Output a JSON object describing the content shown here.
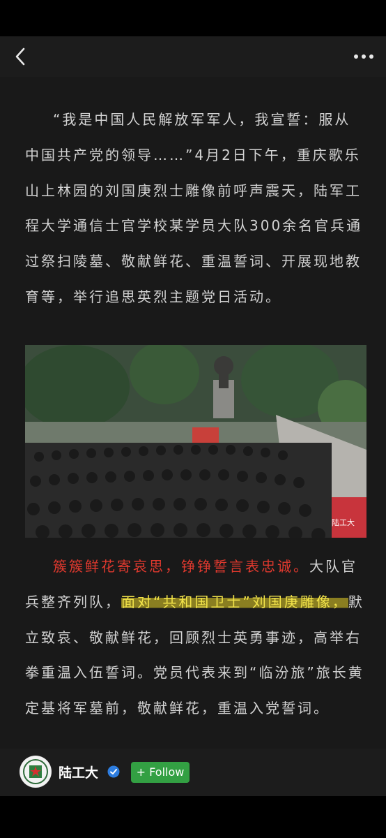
{
  "nav": {
    "back_icon": "chevron-left-icon",
    "more_icon": "ellipsis-icon"
  },
  "article": {
    "p1": "“我是中国人民解放军军人，我宣誓：服从中国共产党的领导……”4月2日下午，重庆歌乐山上林园的刘国庚烈士雕像前呼声震天，陆军工程大学通信士官学校某学员大队300余名官兵通过祭扫陵墓、敬献鲜花、重温誓词、开展现地教育等，举行追思英烈主题党日活动。",
    "photo_watermark": "陆工大",
    "p2_red": "簇簇鲜花寄哀思，铮铮誓言表忠诚。",
    "p2_a": "大队官兵整齐列队，",
    "p2_highlight": "面对“共和国卫士”刘国庚雕像，",
    "p2_b": "默立致哀、敬献鲜花，回顾烈士英勇事迹，高举右拳重温入伍誓词。党员代表来到“临汾旅”旅长黄定基将军墓前，敬献鲜花，重温入党誓词。"
  },
  "footer": {
    "account_name": "陆工大",
    "follow_label": "+ Follow",
    "verified_icon": "verified-badge-icon"
  },
  "colors": {
    "nav_bg": "#1c1c1c",
    "content_bg": "#191919",
    "red_text": "#e0392e",
    "highlight": "#f2e34a",
    "follow_green": "#33a043"
  }
}
